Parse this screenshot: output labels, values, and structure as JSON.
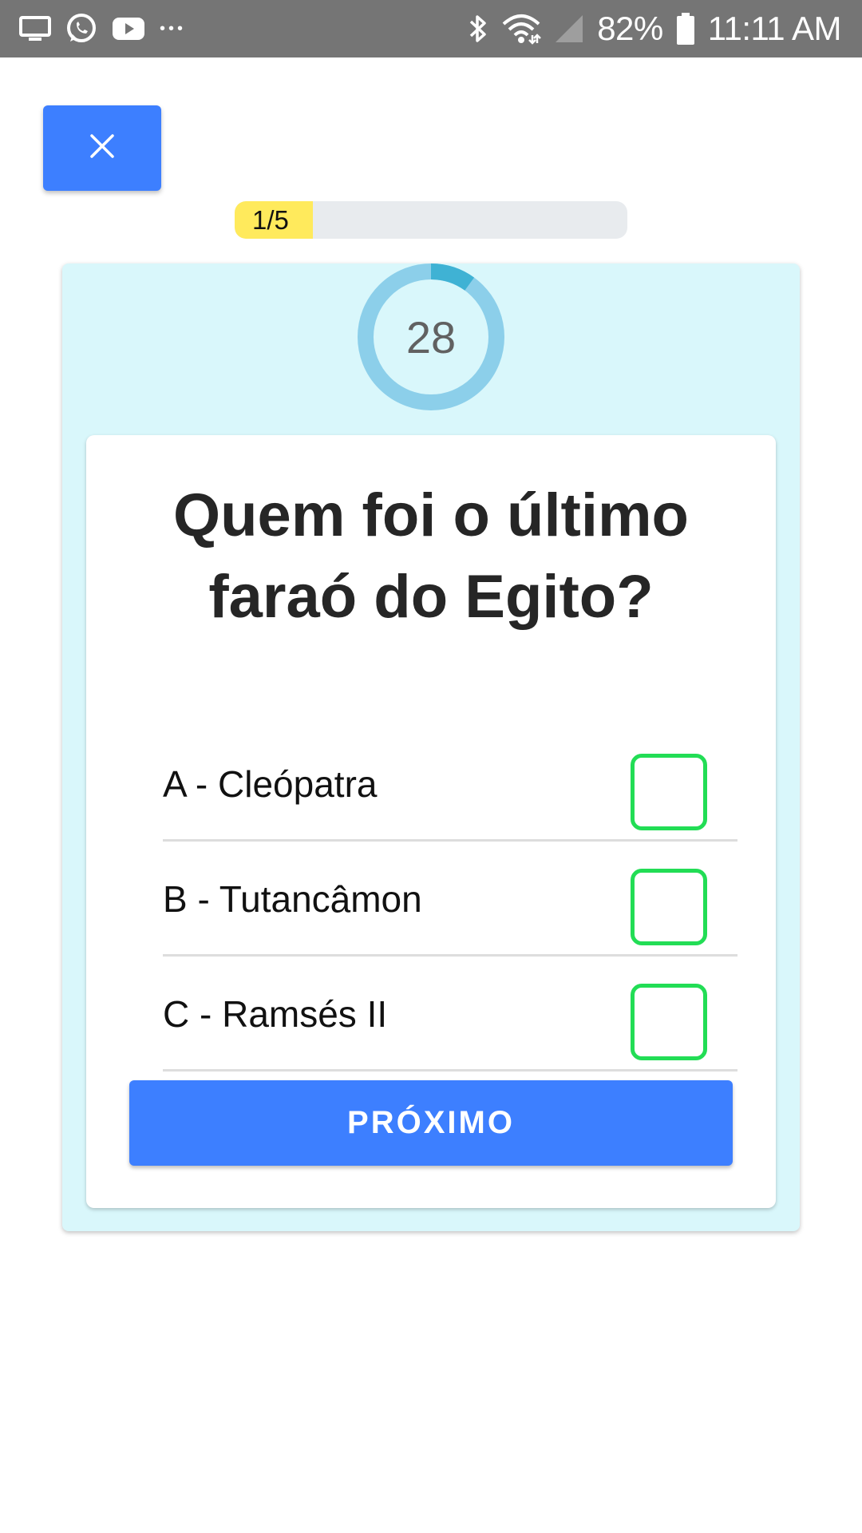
{
  "status_bar": {
    "battery_percent": "82%",
    "time": "11:11 AM",
    "overflow_dots": "•••"
  },
  "quiz": {
    "progress": {
      "label": "1/5",
      "current": 1,
      "total": 5,
      "fraction": 0.2
    },
    "timer": {
      "value": "28",
      "remaining_fraction": 0.9
    },
    "question": "Quem foi o último faraó do Egito?",
    "options": [
      {
        "label": "A - Cleópatra"
      },
      {
        "label": "B - Tutancâmon"
      },
      {
        "label": "C - Ramsés II"
      }
    ],
    "next_button": "PRÓXIMO"
  },
  "colors": {
    "status_bar_bg": "#757575",
    "primary_button": "#3d7fff",
    "progress_fill": "#ffea5c",
    "progress_track": "#e8ebee",
    "card_bg": "#d9f7fb",
    "timer_ring": "#8ccfea",
    "timer_elapsed": "#3fb2d4",
    "checkbox_border": "#22dd55"
  }
}
